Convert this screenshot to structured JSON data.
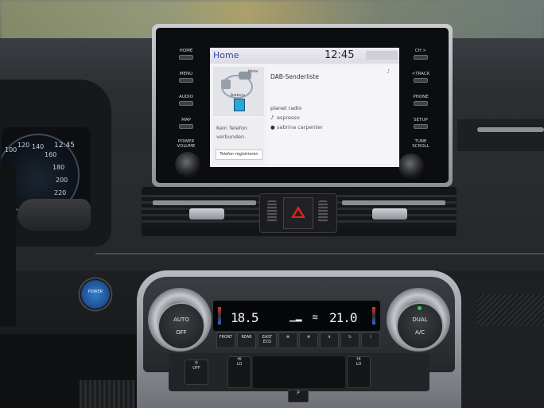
{
  "head_unit": {
    "left_buttons": [
      "HOME",
      "MENU",
      "AUDIO",
      "MAP",
      "POWER\nVOLUME"
    ],
    "right_buttons": [
      "CH >",
      "<TRACK",
      "PHONE",
      "SETUP",
      "TUNE\nSCROLL"
    ],
    "screen": {
      "title": "Home",
      "clock": "12:45",
      "energy_labels": {
        "motor": "Motor",
        "battery": "Batterie"
      },
      "phone_status": "Kein Telefon verbunden.",
      "phone_button": "Telefon registrieren",
      "dab_title": "DAB-Senderliste",
      "station": "planet radio",
      "track": "espresso",
      "artist": "sabrina carpenter"
    }
  },
  "cluster": {
    "clock": "12:45",
    "gauge_numbers": [
      "100",
      "120",
      "140",
      "160",
      "180",
      "200",
      "220"
    ]
  },
  "power_button": {
    "label": "POWER"
  },
  "climate": {
    "left_temp": "18.5",
    "right_temp": "21.0",
    "left_dial": {
      "label": "AUTO",
      "sub": "OFF"
    },
    "right_dial": {
      "label": "DUAL",
      "sub": "A/C"
    },
    "buttons": [
      "FRONT",
      "REAR",
      "EAST\nECO",
      "",
      "",
      "",
      ""
    ],
    "seat_left": "HI\nLO",
    "seat_right": "HI\nLO",
    "lower_left": "OFF",
    "bottom": "P"
  },
  "colors": {
    "screen_title": "#2a4aa0",
    "power_blue": "#2f7fd0",
    "hazard_red": "#dd2222",
    "dual_led": "#2cd34a"
  }
}
